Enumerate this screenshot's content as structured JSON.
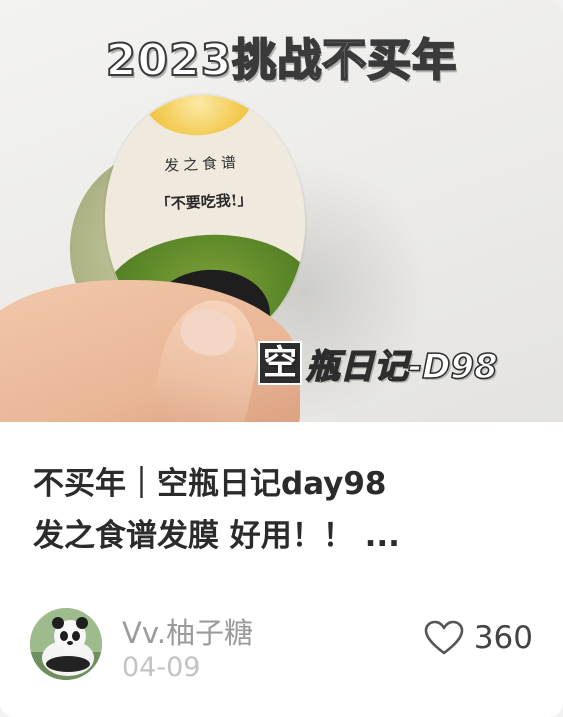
{
  "cover": {
    "overlay_title": "2023挑战不买年",
    "overlay_sub_boxed": "空",
    "overlay_sub_rest": "瓶日记-D98",
    "lid_brand": "发之食谱",
    "lid_slogan": "「不要吃我!」"
  },
  "post": {
    "title_line1": "不买年｜空瓶日记day98",
    "title_line2": "发之食谱发膜 好用！！ ..."
  },
  "author": {
    "name": "Vv.柚子糖",
    "date": "04-09",
    "avatar_icon": "panda-avatar"
  },
  "likes": {
    "icon": "heart-icon",
    "count": "360"
  },
  "colors": {
    "title_text": "#2b2b2b",
    "author_text": "#9b9b9b",
    "date_text": "#c3c3c3",
    "card_bg": "#ffffff"
  }
}
